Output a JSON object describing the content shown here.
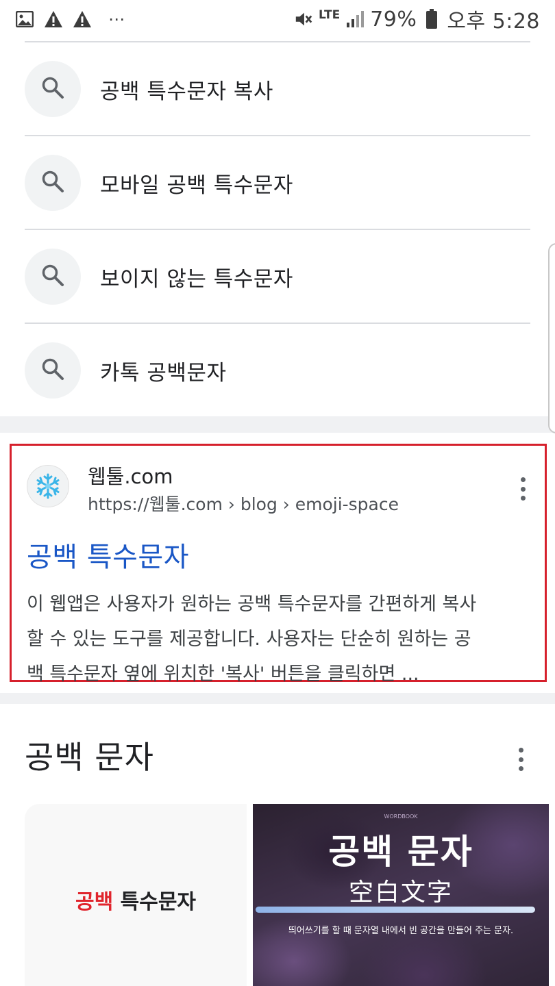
{
  "status_bar": {
    "signal_text": "LTE",
    "battery": "79%",
    "time": "오후 5:28",
    "dots": "⋯",
    "icons": [
      "gallery-icon",
      "warning-icon",
      "warning-icon",
      "more-icon",
      "mute-icon",
      "signal-icon",
      "battery-icon"
    ]
  },
  "suggestions": [
    {
      "label": "공백 특수문자 복사"
    },
    {
      "label": "모바일 공백 특수문자"
    },
    {
      "label": "보이지 않는 특수문자"
    },
    {
      "label": "카톡 공백문자"
    }
  ],
  "result": {
    "site_name": "웹툴.com",
    "url": "https://웹툴.com › blog › emoji-space",
    "title": "공백 특수문자",
    "snippet_lines": [
      "이 웹앱은 사용자가 원하는 공백 특수문자를 간편하게 복사",
      "할 수 있는 도구를 제공합니다. 사용자는 단순히 원하는 공",
      "백 특수문자 옆에 위치한 '복사' 버튼을 클릭하면 ..."
    ],
    "favicon": "snowflake-icon"
  },
  "section": {
    "title": "공백 문자",
    "images": [
      {
        "text_red": "공백",
        "text_dark": " 특수문자"
      },
      {
        "title": "공백 문자",
        "subtitle": "空白文字",
        "caption": "띄어쓰기를 할 때 문자열 내에서 빈 공간을 만들어 주는 문자.",
        "tiny": "WORDBOOK"
      }
    ]
  },
  "colors": {
    "link_blue": "#1a57c6",
    "highlight_red": "#d6202c",
    "accent_red_text": "#e0242c"
  }
}
